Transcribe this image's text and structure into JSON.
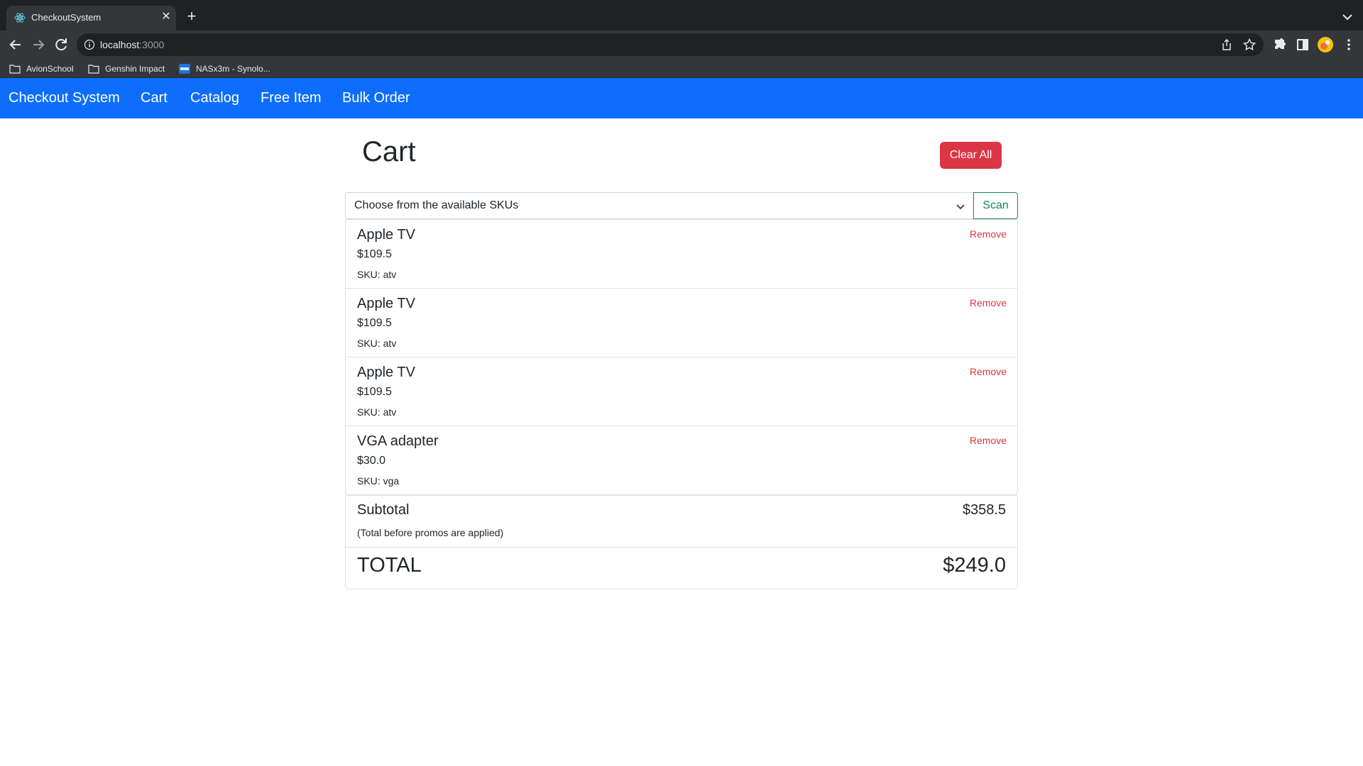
{
  "browser": {
    "tab_title": "CheckoutSystem",
    "url_host": "localhost",
    "url_port": ":3000",
    "bookmarks": [
      {
        "label": "AvionSchool",
        "icon": "folder-icon"
      },
      {
        "label": "Genshin Impact",
        "icon": "folder-icon"
      },
      {
        "label": "NASx3m - Synolo...",
        "icon": "dsm-icon"
      }
    ]
  },
  "navbar": {
    "brand": "Checkout System",
    "links": [
      "Cart",
      "Catalog",
      "Free Item",
      "Bulk Order"
    ],
    "color": "#0d6efd"
  },
  "page": {
    "title": "Cart",
    "clear_all_label": "Clear All",
    "sku_select": {
      "selected": "Choose from the available SKUs"
    },
    "scan_label": "Scan"
  },
  "cart": {
    "remove_label": "Remove",
    "items": [
      {
        "name": "Apple TV",
        "price": "$109.5",
        "sku": "SKU: atv"
      },
      {
        "name": "Apple TV",
        "price": "$109.5",
        "sku": "SKU: atv"
      },
      {
        "name": "Apple TV",
        "price": "$109.5",
        "sku": "SKU: atv"
      },
      {
        "name": "VGA adapter",
        "price": "$30.0",
        "sku": "SKU: vga"
      }
    ]
  },
  "totals": {
    "subtotal_label": "Subtotal",
    "subtotal_value": "$358.5",
    "subtotal_note": "(Total before promos are applied)",
    "total_label": "TOTAL",
    "total_value": "$249.0"
  },
  "colors": {
    "danger": "#dc3545",
    "success": "#198754",
    "primary": "#0d6efd"
  }
}
